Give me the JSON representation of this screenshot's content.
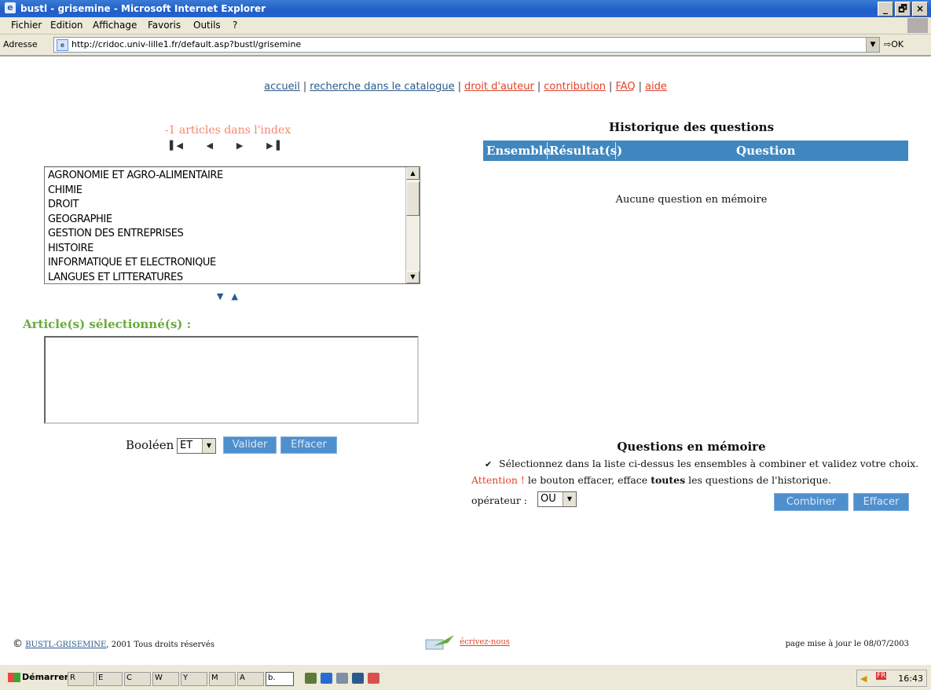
{
  "window": {
    "title": "bustl - grisemine - Microsoft Internet Explorer",
    "controls": [
      "_",
      "🗗",
      "×"
    ]
  },
  "menu": [
    "Fichier",
    "Edition",
    "Affichage",
    "Favoris",
    "Outils",
    "?"
  ],
  "address": {
    "label": "Adresse",
    "url": "http://cridoc.univ-lille1.fr/default.asp?bustl/grisemine",
    "go": "OK"
  },
  "nav": {
    "links": [
      {
        "label": "accueil",
        "color": "#2a5b8c"
      },
      {
        "label": "recherche dans le catalogue",
        "color": "#2a5b8c"
      },
      {
        "label": "droit d'auteur",
        "color": "#e0432a"
      },
      {
        "label": "contribution",
        "color": "#e0432a"
      },
      {
        "label": "FAQ",
        "color": "#e0432a"
      },
      {
        "label": "aide",
        "color": "#e0432a"
      }
    ],
    "separator": "|"
  },
  "index": {
    "count_text": "-1 articles dans l'index",
    "nav_arrows": [
      "first",
      "previous",
      "next",
      "last"
    ],
    "items": [
      "AGRONOMIE ET AGRO-ALIMENTAIRE",
      "CHIMIE",
      "DROIT",
      "GEOGRAPHIE",
      "GESTION DES ENTREPRISES",
      "HISTOIRE",
      "INFORMATIQUE ET ELECTRONIQUE",
      "LANGUES ET LITTERATURES"
    ]
  },
  "selected": {
    "label": "Article(s) sélectionné(s) :"
  },
  "boolean": {
    "label": "Booléen",
    "value": "ET",
    "validate": "Valider",
    "clear": "Effacer"
  },
  "history": {
    "title": "Historique des questions",
    "columns": [
      "Ensemble",
      "Résultat(s)",
      "Question"
    ],
    "empty": "Aucune question en mémoire"
  },
  "memory": {
    "title": "Questions en mémoire",
    "note": "Sélectionnez dans la liste ci-dessus les ensembles à combiner et validez votre choix.",
    "warn_prefix": "Attention !",
    "warn_a": " le bouton effacer, efface ",
    "warn_bold": "toutes",
    "warn_b": " les questions de l'historique.",
    "operator_label": "opérateur :",
    "operator_value": "OU",
    "combine": "Combiner",
    "clear": "Effacer"
  },
  "footer": {
    "copyright_symbol": "©",
    "copyright_link": "BUSTL-GRISEMINE",
    "copyright_text": ", 2001 Tous droits réservés",
    "write_us": "écrivez-nous",
    "updated": "page mise à jour le 08/07/2003"
  },
  "taskbar": {
    "start": "Démarrer",
    "buttons": [
      "R",
      "E",
      "C",
      "W",
      "Y",
      "M",
      "A",
      "b."
    ],
    "lang": "FR",
    "clock": "16:43"
  },
  "colors": {
    "title_blue": "#1f5fc7",
    "header_blue": "#3f87bf",
    "link_blue": "#2a5b8c",
    "link_red": "#e0432a",
    "green_label": "#6aab3b",
    "count_orange": "#f08a6a"
  }
}
